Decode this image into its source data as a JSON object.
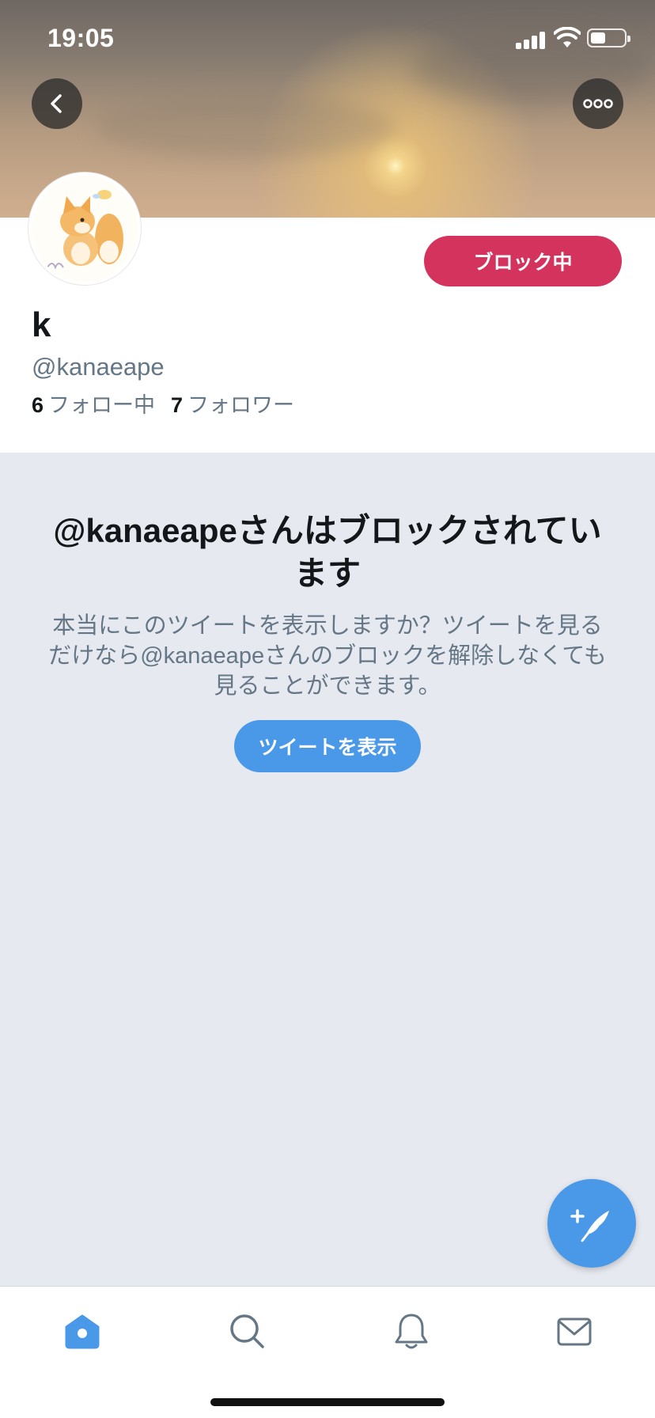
{
  "status_bar": {
    "time": "19:05",
    "battery_level": 0.45
  },
  "header": {
    "back_icon": "chevron-left-icon",
    "more_icon": "more-dots-icon"
  },
  "profile": {
    "display_name": "k",
    "handle": "@kanaeape",
    "following_count": "6",
    "following_label": "フォロー中",
    "followers_count": "7",
    "followers_label": "フォロワー",
    "block_button_label": "ブロック中",
    "block_button_color": "#d4335d"
  },
  "blocked_notice": {
    "title": "@kanaeapeさんはブロックされています",
    "description": "本当にこのツイートを表示しますか？ツイートを見るだけなら@kanaeapeさんのブロックを解除しなくても見ることができます。",
    "view_button_label": "ツイートを表示",
    "accent_color": "#4a99e9"
  },
  "compose_fab": {
    "icon": "compose-feather-icon"
  },
  "tab_bar": {
    "tabs": [
      {
        "name": "home",
        "icon": "home-icon",
        "active": true
      },
      {
        "name": "search",
        "icon": "search-icon",
        "active": false
      },
      {
        "name": "notifications",
        "icon": "bell-icon",
        "active": false
      },
      {
        "name": "messages",
        "icon": "mail-icon",
        "active": false
      }
    ]
  }
}
